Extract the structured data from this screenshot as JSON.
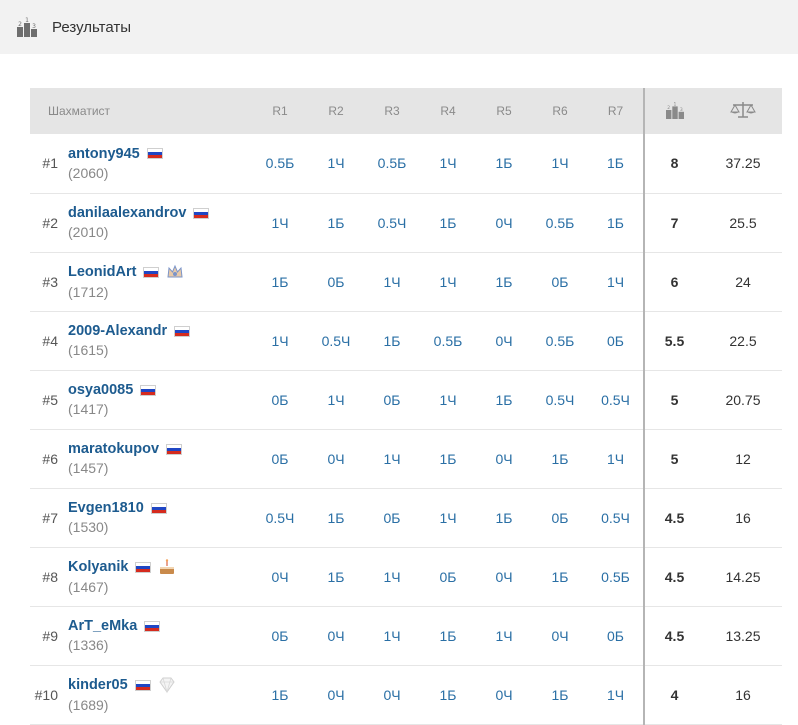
{
  "header": {
    "title": "Результаты"
  },
  "table": {
    "columns": {
      "player": "Шахматист",
      "rounds": [
        "R1",
        "R2",
        "R3",
        "R4",
        "R5",
        "R6",
        "R7"
      ]
    },
    "rows": [
      {
        "rank": "#1",
        "name": "antony945",
        "rating": "(2060)",
        "results": [
          "0.5Б",
          "1Ч",
          "0.5Б",
          "1Ч",
          "1Б",
          "1Ч",
          "1Б"
        ],
        "score": "8",
        "tiebreak": "37.25",
        "badge": null
      },
      {
        "rank": "#2",
        "name": "danilaalexandrov",
        "rating": "(2010)",
        "results": [
          "1Ч",
          "1Б",
          "0.5Ч",
          "1Б",
          "0Ч",
          "0.5Б",
          "1Б"
        ],
        "score": "7",
        "tiebreak": "25.5",
        "badge": null
      },
      {
        "rank": "#3",
        "name": "LeonidArt",
        "rating": "(1712)",
        "results": [
          "1Б",
          "0Б",
          "1Ч",
          "1Ч",
          "1Б",
          "0Б",
          "1Ч"
        ],
        "score": "6",
        "tiebreak": "24",
        "badge": "crown-icon"
      },
      {
        "rank": "#4",
        "name": "2009-Alexandr",
        "rating": "(1615)",
        "results": [
          "1Ч",
          "0.5Ч",
          "1Б",
          "0.5Б",
          "0Ч",
          "0.5Б",
          "0Б"
        ],
        "score": "5.5",
        "tiebreak": "22.5",
        "badge": null
      },
      {
        "rank": "#5",
        "name": "osya0085",
        "rating": "(1417)",
        "results": [
          "0Б",
          "1Ч",
          "0Б",
          "1Ч",
          "1Б",
          "0.5Ч",
          "0.5Ч"
        ],
        "score": "5",
        "tiebreak": "20.75",
        "badge": null
      },
      {
        "rank": "#6",
        "name": "maratokupov",
        "rating": "(1457)",
        "results": [
          "0Б",
          "0Ч",
          "1Ч",
          "1Б",
          "0Ч",
          "1Б",
          "1Ч"
        ],
        "score": "5",
        "tiebreak": "12",
        "badge": null
      },
      {
        "rank": "#7",
        "name": "Evgen1810",
        "rating": "(1530)",
        "results": [
          "0.5Ч",
          "1Б",
          "0Б",
          "1Ч",
          "1Б",
          "0Б",
          "0.5Ч"
        ],
        "score": "4.5",
        "tiebreak": "16",
        "badge": null
      },
      {
        "rank": "#8",
        "name": "Kolyanik",
        "rating": "(1467)",
        "results": [
          "0Ч",
          "1Б",
          "1Ч",
          "0Б",
          "0Ч",
          "1Б",
          "0.5Б"
        ],
        "score": "4.5",
        "tiebreak": "14.25",
        "badge": "cake-icon"
      },
      {
        "rank": "#9",
        "name": "ArT_eMka",
        "rating": "(1336)",
        "results": [
          "0Б",
          "0Ч",
          "1Ч",
          "1Б",
          "1Ч",
          "0Ч",
          "0Б"
        ],
        "score": "4.5",
        "tiebreak": "13.25",
        "badge": null
      },
      {
        "rank": "#10",
        "name": "kinder05",
        "rating": "(1689)",
        "results": [
          "1Б",
          "0Ч",
          "0Ч",
          "1Б",
          "0Ч",
          "1Б",
          "1Ч"
        ],
        "score": "4",
        "tiebreak": "16",
        "badge": "diamond-icon"
      }
    ]
  }
}
